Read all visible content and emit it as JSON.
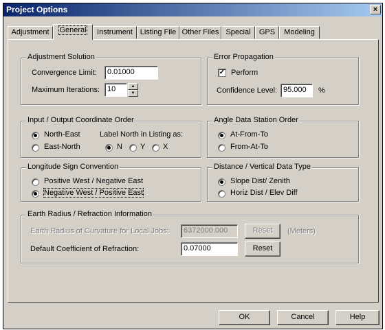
{
  "window": {
    "title": "Project Options",
    "close": "×"
  },
  "tabs": [
    "Adjustment",
    "General",
    "Instrument",
    "Listing File",
    "Other Files",
    "Special",
    "GPS",
    "Modeling"
  ],
  "adjustment_solution": {
    "legend": "Adjustment Solution",
    "convergence_label": "Convergence Limit:",
    "convergence_value": "0.01000",
    "max_iter_label": "Maximum Iterations:",
    "max_iter_value": "10"
  },
  "error_propagation": {
    "legend": "Error Propagation",
    "perform_label": "Perform",
    "perform_checked": true,
    "confidence_label": "Confidence Level:",
    "confidence_value": "95.000",
    "confidence_unit": "%"
  },
  "coord_order": {
    "legend": "Input / Output Coordinate Order",
    "north_east": "North-East",
    "east_north": "East-North",
    "label_north": "Label North in Listing as:",
    "n": "N",
    "y": "Y",
    "x": "X",
    "selected_order": "North-East",
    "selected_label": "N"
  },
  "angle_order": {
    "legend": "Angle Data Station Order",
    "at_from_to": "At-From-To",
    "from_at_to": "From-At-To",
    "selected": "At-From-To"
  },
  "longitude": {
    "legend": "Longitude Sign Convention",
    "pos_west": "Positive West / Negative East",
    "neg_west": "Negative West / Positive East",
    "selected": "Negative West / Positive East"
  },
  "distance_type": {
    "legend": "Distance / Vertical Data Type",
    "slope": "Slope Dist/ Zenith",
    "horiz": "Horiz Dist / Elev Diff",
    "selected": "Slope Dist/ Zenith"
  },
  "earth": {
    "legend": "Earth Radius / Refraction Information",
    "radius_label": "Earth Radius of Curvature for Local Jobs:",
    "radius_value": "6372000.000",
    "reset": "Reset",
    "meters": "(Meters)",
    "refraction_label": "Default Coefficient of Refraction:",
    "refraction_value": "0.07000"
  },
  "buttons": {
    "ok": "OK",
    "cancel": "Cancel",
    "help": "Help"
  },
  "colors": {
    "face": "#d4d0c8",
    "title_start": "#0a246a",
    "title_end": "#a6caf0"
  }
}
